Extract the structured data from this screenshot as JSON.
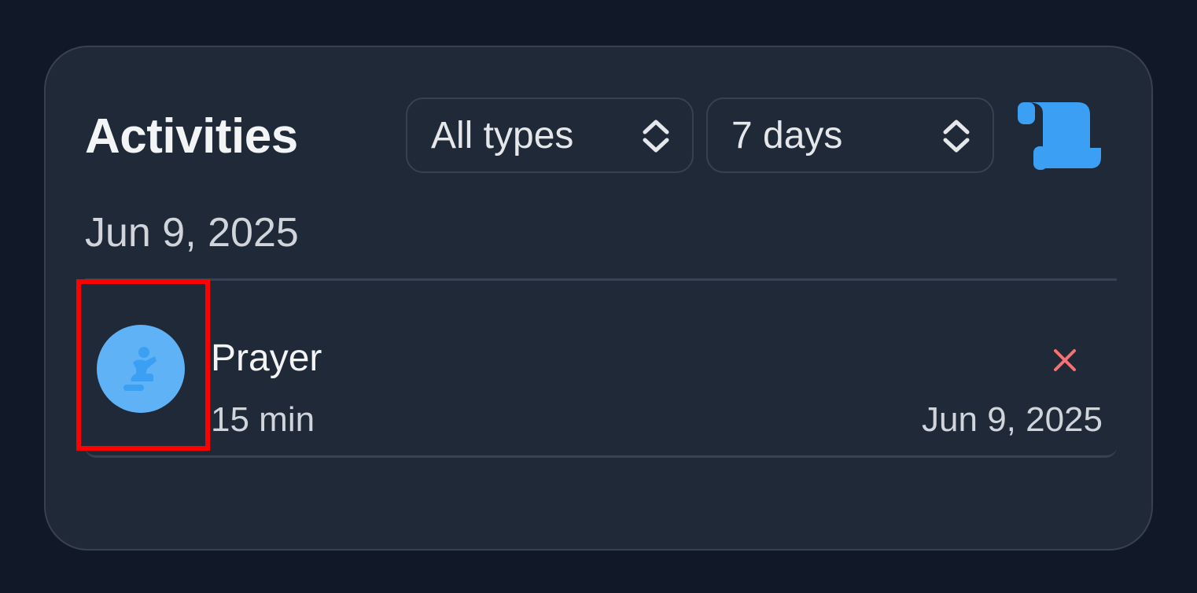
{
  "card": {
    "title": "Activities",
    "filters": {
      "type_select": {
        "value": "All types"
      },
      "range_select": {
        "value": "7 days"
      }
    },
    "header_icon": "scroll-icon",
    "groups": [
      {
        "date": "Jun 9, 2025",
        "items": [
          {
            "title": "Prayer",
            "duration": "15 min",
            "date": "Jun 9, 2025",
            "icon": "praying-person-icon",
            "delete_icon": "close-icon"
          }
        ]
      }
    ]
  },
  "colors": {
    "background": "#111827",
    "card": "#1f2937",
    "border": "#374151",
    "accent_blue": "#3b9ff3",
    "avatar_blue": "#60b2f7",
    "delete_red": "#f87171",
    "highlight": "#ff0000"
  }
}
